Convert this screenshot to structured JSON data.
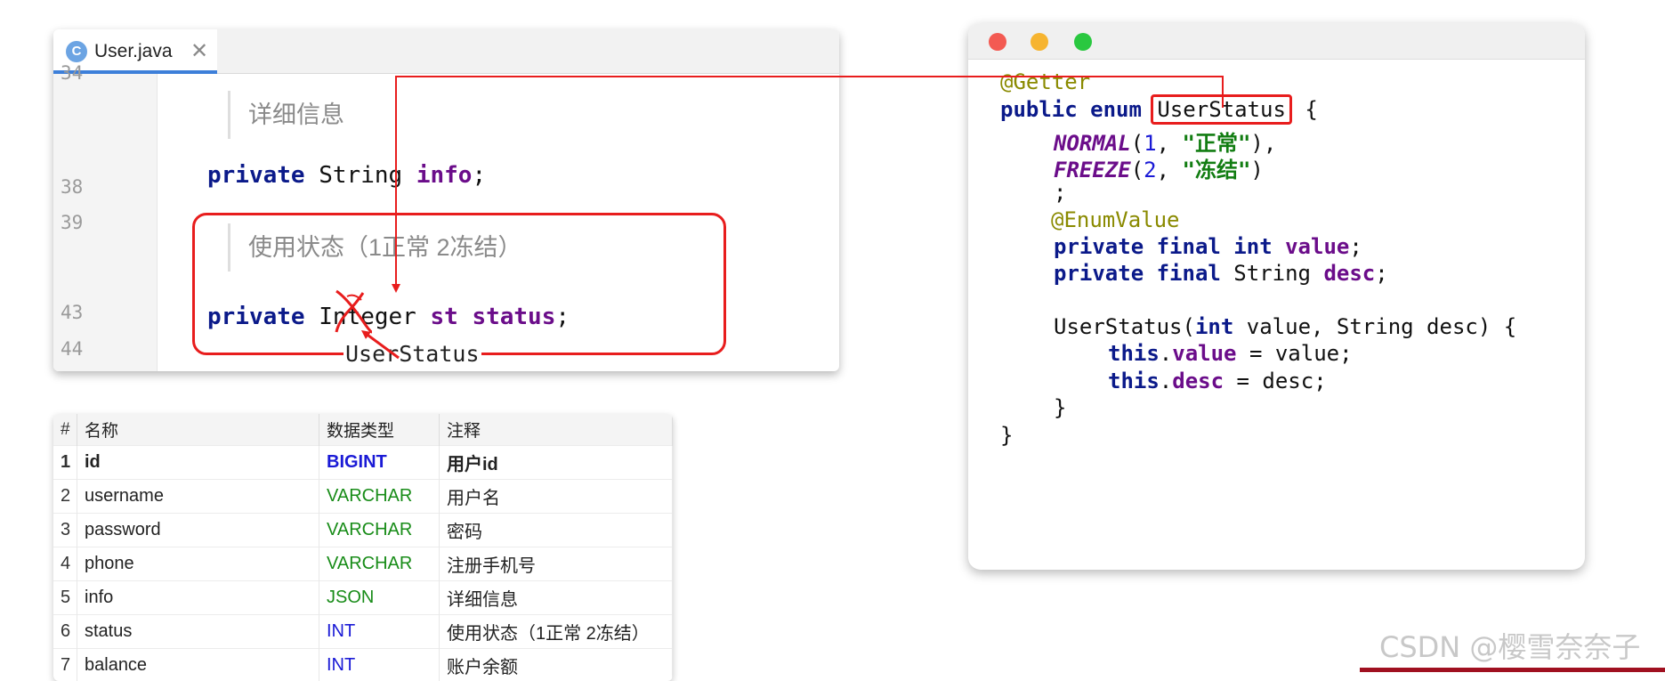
{
  "editor": {
    "tab_label": "User.java",
    "tab_icon_letter": "C",
    "close_glyph": "✕",
    "line_numbers": [
      "34",
      "38",
      "39",
      "43",
      "44"
    ],
    "doc_info": "详细信息",
    "doc_status": "使用状态（1正常 2冻结）",
    "line38": {
      "kw": "private",
      "type": "String",
      "name": "info",
      "end": ";"
    },
    "line43": {
      "kw": "private",
      "type": "Integer",
      "mid": "st",
      "name": "status",
      "end": ";"
    },
    "replacement_label": "UserStatus"
  },
  "db_table": {
    "headers": [
      "#",
      "名称",
      "数据类型",
      "注释"
    ],
    "rows": [
      {
        "n": "1",
        "name": "id",
        "type": "BIGINT",
        "comment": "用户id"
      },
      {
        "n": "2",
        "name": "username",
        "type": "VARCHAR",
        "comment": "用户名"
      },
      {
        "n": "3",
        "name": "password",
        "type": "VARCHAR",
        "comment": "密码"
      },
      {
        "n": "4",
        "name": "phone",
        "type": "VARCHAR",
        "comment": "注册手机号"
      },
      {
        "n": "5",
        "name": "info",
        "type": "JSON",
        "comment": "详细信息"
      },
      {
        "n": "6",
        "name": "status",
        "type": "INT",
        "comment": "使用状态（1正常 2冻结）"
      },
      {
        "n": "7",
        "name": "balance",
        "type": "INT",
        "comment": "账户余额"
      }
    ]
  },
  "enum_code": {
    "annotation_getter": "@Getter",
    "decl_kw": "public enum",
    "enum_name": "UserStatus",
    "open_brace": "{",
    "c1_name": "NORMAL",
    "c1_num": "1",
    "c1_str": "\"正常\"",
    "c2_name": "FREEZE",
    "c2_num": "2",
    "c2_str": "\"冻结\"",
    "semicolon": ";",
    "annotation_enumvalue": "@EnumValue",
    "field1_kw": "private final int",
    "field1_name": "value",
    "field2_kw": "private final",
    "field2_type": "String",
    "field2_name": "desc",
    "ctor_name": "UserStatus",
    "ctor_params": "value, String desc) {",
    "ctor_int": "int",
    "this_kw": "this",
    "assign_value": "value",
    "assign_desc": "desc",
    "close_inner": "}",
    "close_outer": "}"
  },
  "watermark": "CSDN @樱雪奈奈子",
  "colors": {
    "annotation_red": "#e81d1d",
    "keyword": "#0b1a8a",
    "field": "#6b0d8a",
    "string": "#127d12"
  }
}
